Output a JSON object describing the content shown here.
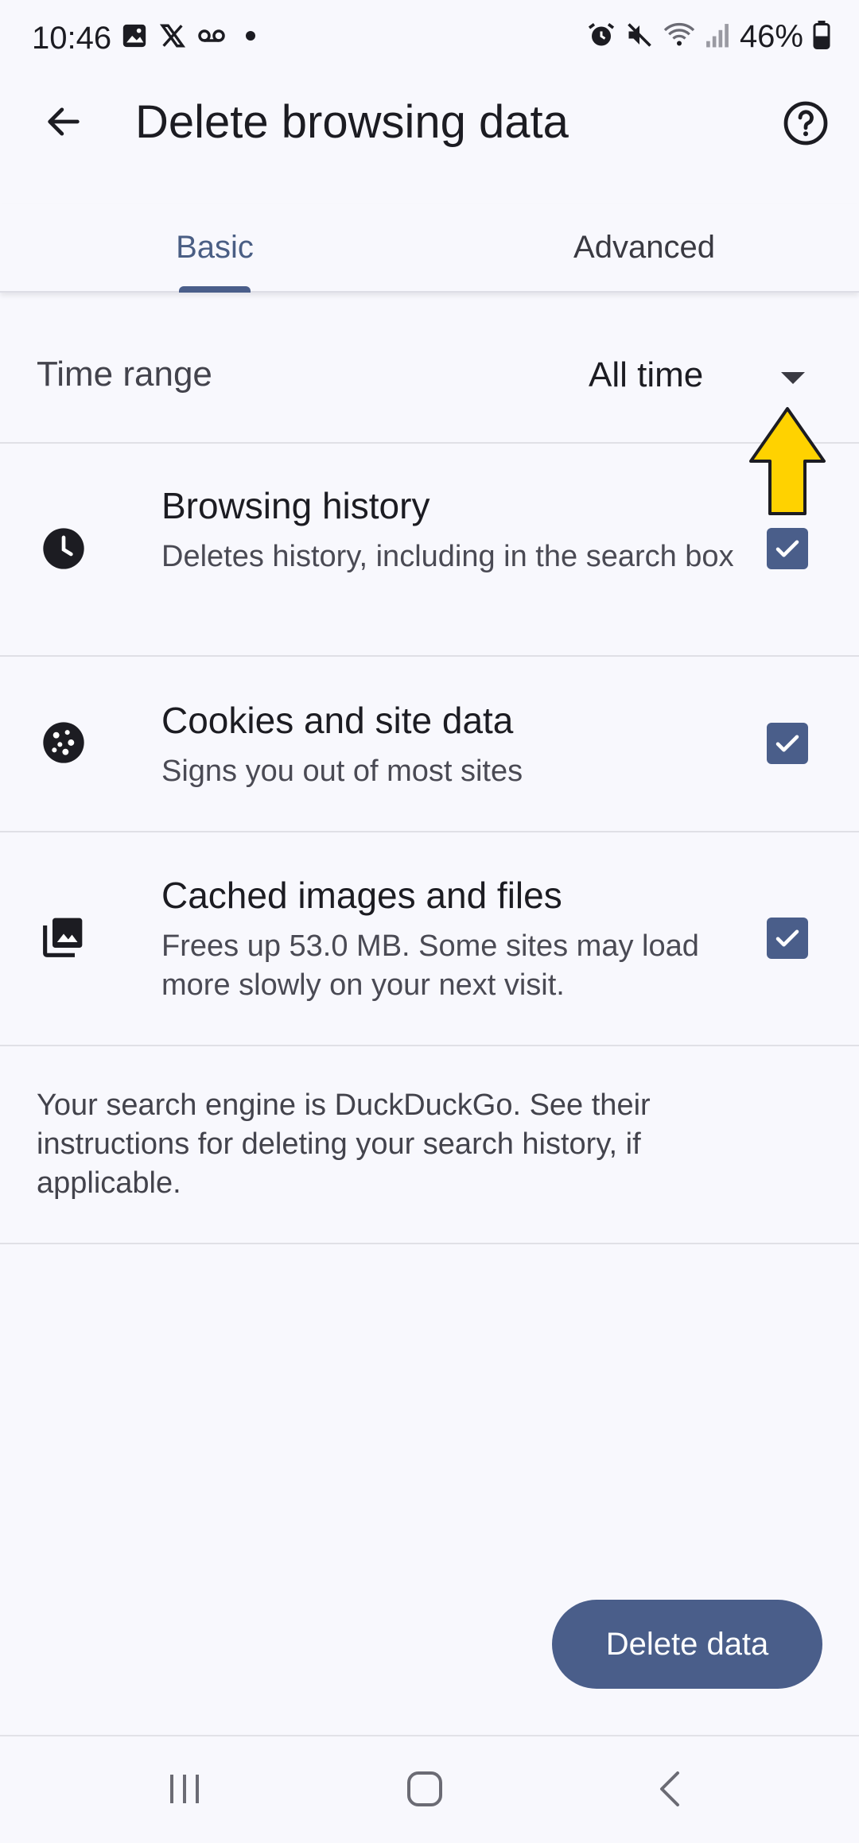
{
  "status_bar": {
    "time": "10:46",
    "battery": "46%",
    "left_icons": [
      "gallery-icon",
      "x-icon",
      "voicemail-icon",
      "dot-icon"
    ],
    "right_icons": [
      "alarm-icon",
      "mute-icon",
      "wifi-icon",
      "signal-icon",
      "battery-icon"
    ]
  },
  "app_bar": {
    "title": "Delete browsing data",
    "back_icon": "arrow-left-icon",
    "help_icon": "help-circle-icon"
  },
  "tabs": [
    {
      "label": "Basic",
      "selected": true
    },
    {
      "label": "Advanced",
      "selected": false
    }
  ],
  "time_range": {
    "label": "Time range",
    "value": "All time"
  },
  "options": [
    {
      "title": "Browsing history",
      "subtitle": "Deletes history, including in the search box",
      "icon": "clock-icon",
      "checked": true
    },
    {
      "title": "Cookies and site data",
      "subtitle": "Signs you out of most sites",
      "icon": "cookie-icon",
      "checked": true
    },
    {
      "title": "Cached images and files",
      "subtitle": "Frees up 53.0 MB. Some sites may load more slowly on your next visit.",
      "icon": "images-icon",
      "checked": true
    }
  ],
  "note": "Your search engine is DuckDuckGo. See their instructions for deleting your search history, if applicable.",
  "delete_button": "Delete data",
  "colors": {
    "accent": "#4a5e8a",
    "background": "#f8f8fd",
    "annotation_arrow": "#ffd200"
  }
}
